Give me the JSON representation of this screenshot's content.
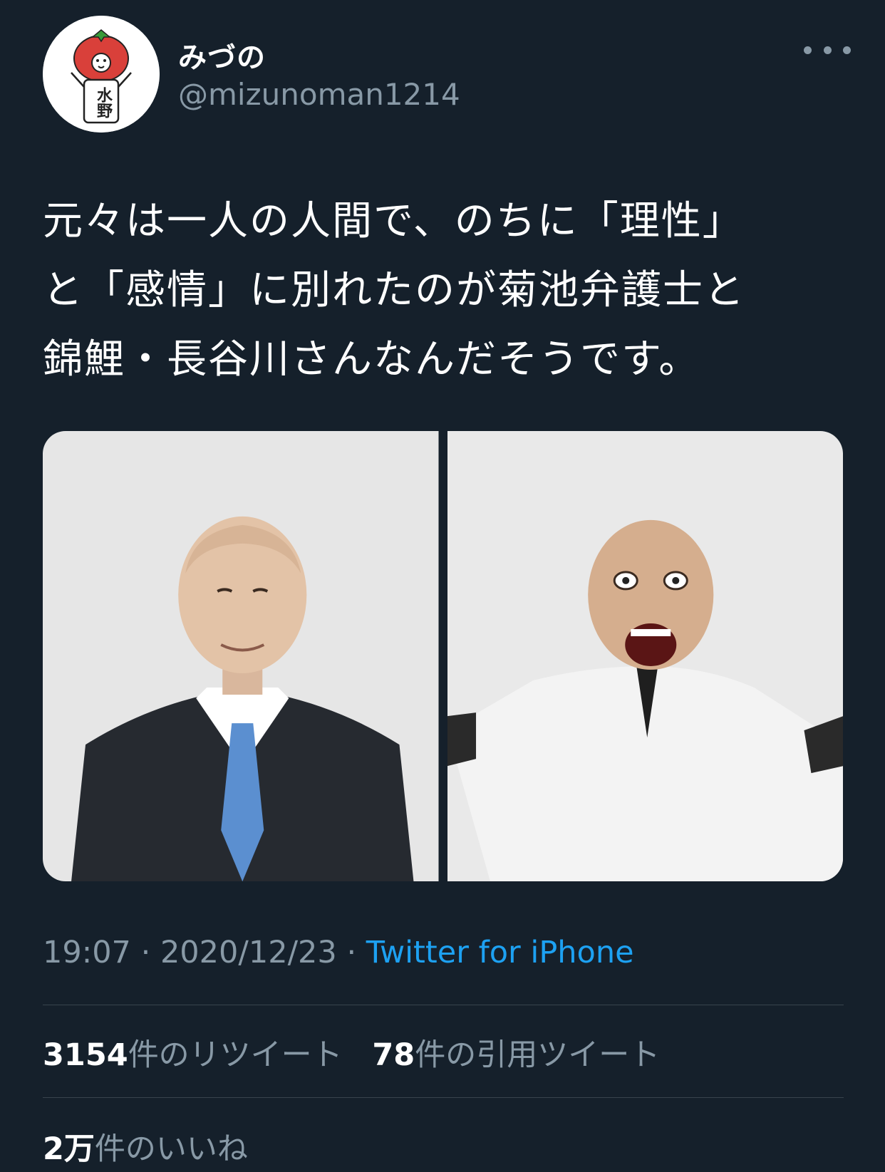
{
  "author": {
    "display_name": "みづの",
    "handle": "@mizunoman1214",
    "avatar_icon": "tomato-character-avatar-icon",
    "avatar_text": "水野"
  },
  "tweet": {
    "lines": [
      "元々は一人の人間で、のちに「理性」",
      "と「感情」に別れたのが菊池弁護士と",
      "錦鯉・長谷川さんなんだそうです。"
    ],
    "media": [
      {
        "icon": "man-in-dark-suit-photo-icon"
      },
      {
        "icon": "man-in-white-suit-shouting-photo-icon"
      }
    ]
  },
  "meta": {
    "time": "19:07",
    "separator": " · ",
    "date": "2020/12/23",
    "source": "Twitter for iPhone"
  },
  "stats": {
    "retweets_count": "3154",
    "retweets_label": "件のリツイート",
    "quotes_count": "78",
    "quotes_label": "件の引用ツイート",
    "likes_count": "2万",
    "likes_label": "件のいいね"
  },
  "colors": {
    "background": "#15202b",
    "secondary_text": "#8899a6",
    "link": "#1da1f2",
    "divider": "#38444d"
  },
  "more_icon": "more-horizontal-icon"
}
